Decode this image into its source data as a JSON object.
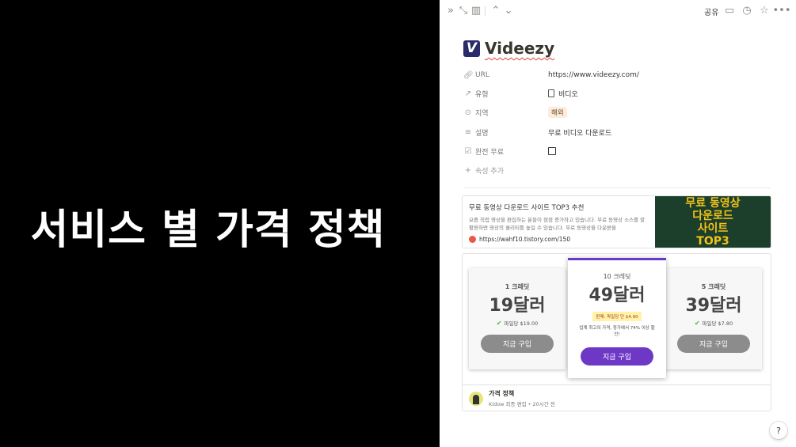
{
  "slide": {
    "title": "서비스 별 가격 정책"
  },
  "topbar": {
    "share_label": "공유",
    "icons": [
      "double-chevron-right-icon",
      "expand-icon",
      "panel-icon",
      "chevron-up-icon",
      "chevron-down-icon",
      "comment-icon",
      "clock-icon",
      "star-icon",
      "more-icon"
    ]
  },
  "page": {
    "title": "Videezy",
    "logo_letter": "V",
    "properties": [
      {
        "icon": "link-icon",
        "label": "URL",
        "value": "https://www.videezy.com/"
      },
      {
        "icon": "arrow-up-right-icon",
        "label": "유형",
        "value": "비디오"
      },
      {
        "icon": "target-icon",
        "label": "지역",
        "value": "해외"
      },
      {
        "icon": "text-lines-icon",
        "label": "설명",
        "value": "무료 비디오 다운로드"
      },
      {
        "icon": "checkbox-icon",
        "label": "완전 무료",
        "value": ""
      }
    ],
    "add_property_label": "속성 추가"
  },
  "bookmark": {
    "title": "무료 동영상 다운로드 사이트 TOP3 추천",
    "description": "요즘 직접 영상을 편집하는 분들이 점점 증가하고 있습니다. 무료 동영상 소스를 잘 활용하면 영상의 퀄리티를 높일 수 있습니다. 무료 동영상을 다운받을",
    "url": "https://wahf10.tistory.com/150",
    "thumb_lines": [
      "무료 동영상",
      "다운로드",
      "사이트",
      "TOP3"
    ]
  },
  "pricing": {
    "cards": [
      {
        "credits": "1 크레딧",
        "price": "19달러",
        "per_file": "파일당 $19.00",
        "button": "지금 구입"
      },
      {
        "credits": "10 크레딧",
        "price": "49달러",
        "badge": "판매: 파일당 단 $4.90",
        "note": "업계 최고의 가격, 정가에서 74% 이상 할인!",
        "button": "지금 구입"
      },
      {
        "credits": "5 크레딧",
        "price": "39달러",
        "per_file": "파일당 $7.80",
        "button": "지금 구입"
      }
    ],
    "page_link": {
      "title": "가격 정책",
      "meta": "Kidow 최종 편집 • 20시간 전"
    }
  },
  "help_label": "?"
}
